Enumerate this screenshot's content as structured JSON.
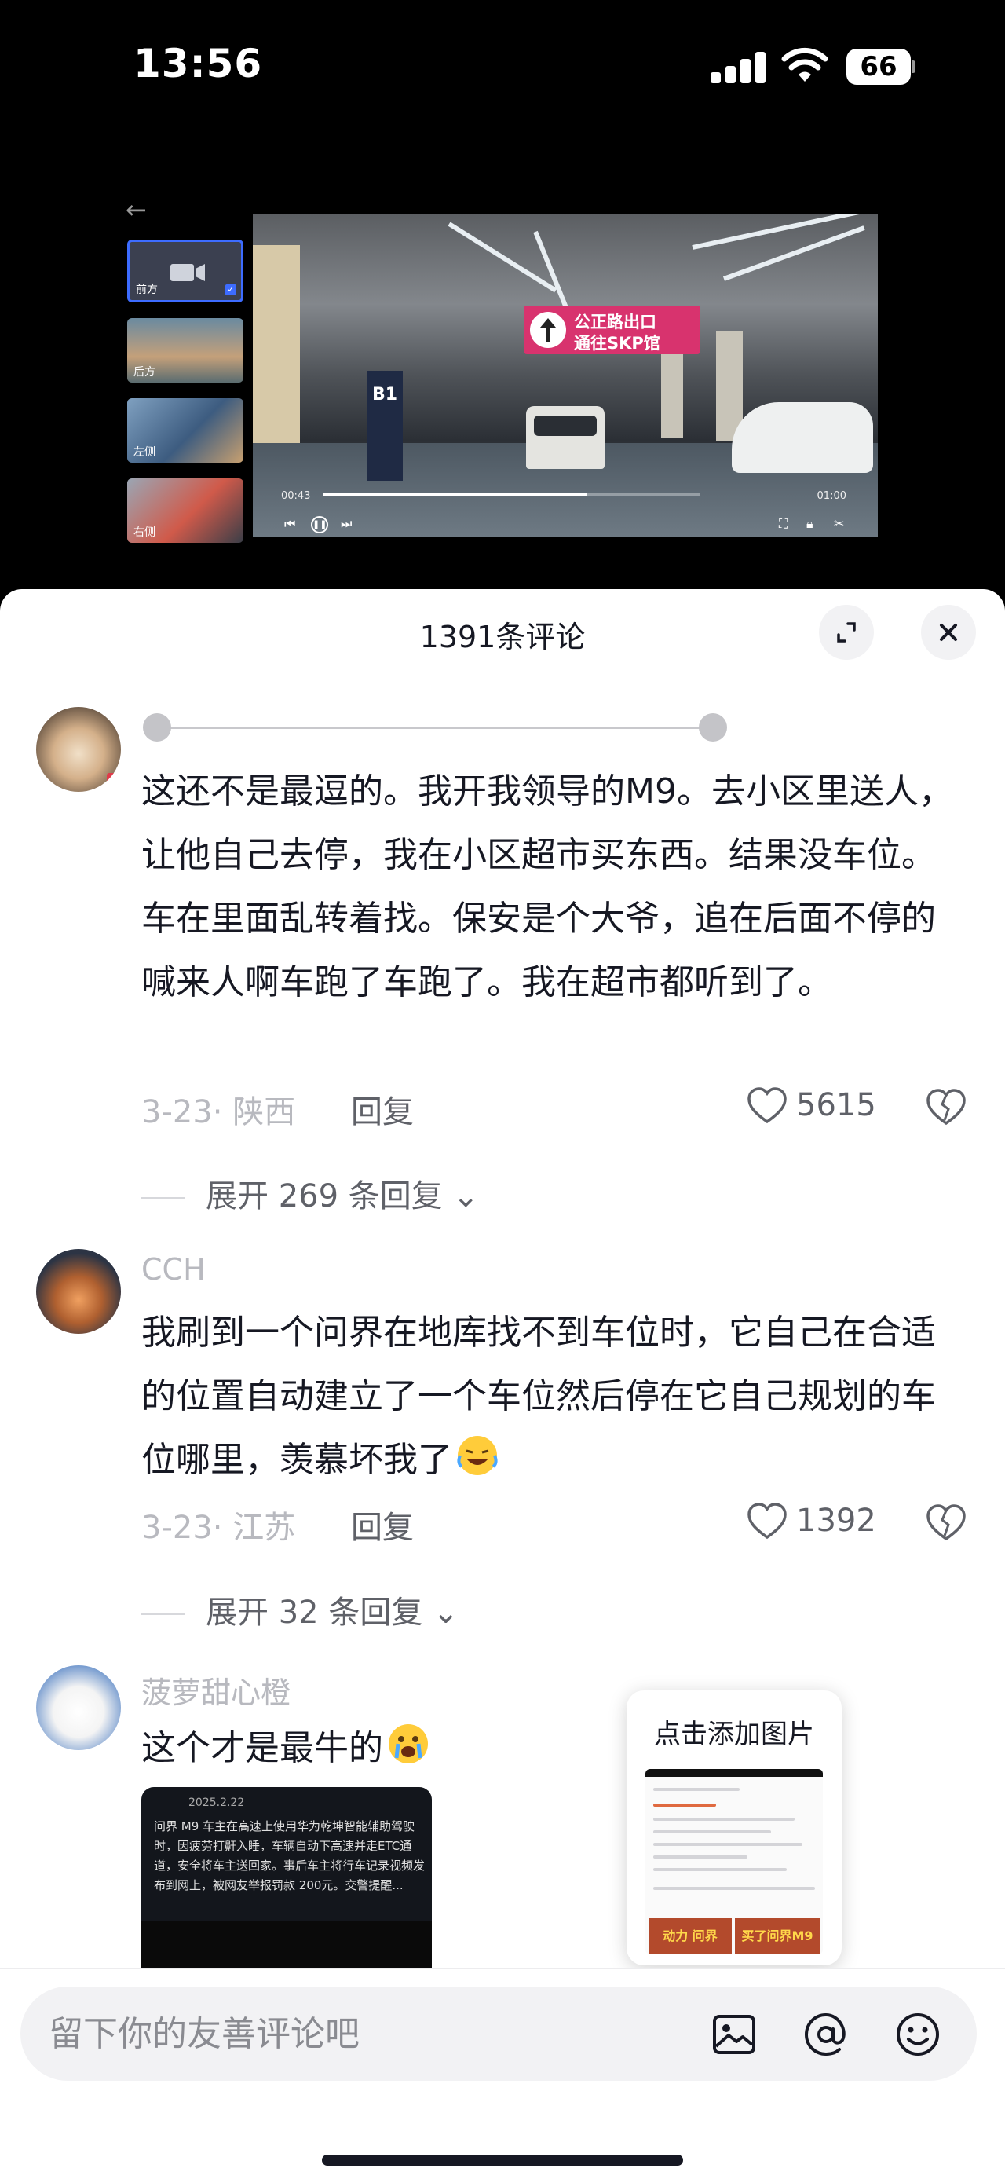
{
  "status_bar": {
    "time": "13:56",
    "battery": "66"
  },
  "video": {
    "thumbnails": [
      {
        "label": "前方",
        "selected": true
      },
      {
        "label": "后方",
        "selected": false
      },
      {
        "label": "左侧",
        "selected": false
      },
      {
        "label": "右侧",
        "selected": false
      }
    ],
    "sign_line1": "公正路出口",
    "sign_line2": "通往SKP馆",
    "b1_label": "B1",
    "elapsed": "00:43",
    "duration": "01:00",
    "progress": 0.7
  },
  "sheet": {
    "title": "1391条评论"
  },
  "comments": [
    {
      "username": "",
      "text": "这还不是最逗的。我开我领导的M9。去小区里送人，让他自己去停，我在小区超市买东西。结果没车位。车在里面乱转着找。保安是个大爷，追在后面不停的喊来人啊车跑了车跑了。我在超市都听到了。",
      "meta": "3-23· 陕西",
      "reply_label": "回复",
      "likes": "5615",
      "expand": "展开 269 条回复"
    },
    {
      "username": "CCH",
      "text": "我刷到一个问界在地库找不到车位时，它自己在合适的位置自动建立了一个车位然后停在它自己规划的车位哪里，羡慕坏我了",
      "meta": "3-23· 江苏",
      "reply_label": "回复",
      "likes": "1392",
      "expand": "展开 32 条回复"
    },
    {
      "username": "菠萝甜心橙",
      "text": "这个才是最牛的",
      "share_date": "2025.2.22",
      "share_text": "问界 M9 车主在高速上使用华为乾坤智能辅助驾驶时，因疲劳打鼾入睡，车辆自动下高速并走ETC通道，安全将车主送回家。事后车主将行车记录视频发布到网上，被网友举报罚款 200元。交警提醒..."
    }
  ],
  "popup": {
    "title": "点击添加图片",
    "banner_left": "动力 问界",
    "banner_right": "买了问界M9"
  },
  "input": {
    "placeholder": "留下你的友善评论吧"
  },
  "colors": {
    "accent": "#161823",
    "muted": "#b8b9bf",
    "sheet_bg": "#ffffff"
  }
}
